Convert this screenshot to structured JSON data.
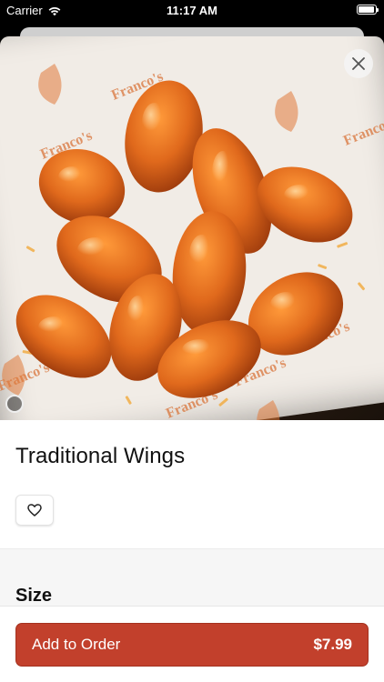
{
  "status_bar": {
    "carrier": "Carrier",
    "time": "11:17 AM",
    "battery_level": 0.95
  },
  "item": {
    "title": "Traditional Wings",
    "image_alt": "Traditional Wings",
    "image_print": "Franco's"
  },
  "icons": {
    "close": "close-icon",
    "favorite": "heart-icon"
  },
  "options": {
    "section_title": "Size"
  },
  "footer": {
    "add_label": "Add to Order",
    "price": "$7.99"
  },
  "colors": {
    "accent": "#c2402c",
    "sauce": "#e0691c"
  }
}
